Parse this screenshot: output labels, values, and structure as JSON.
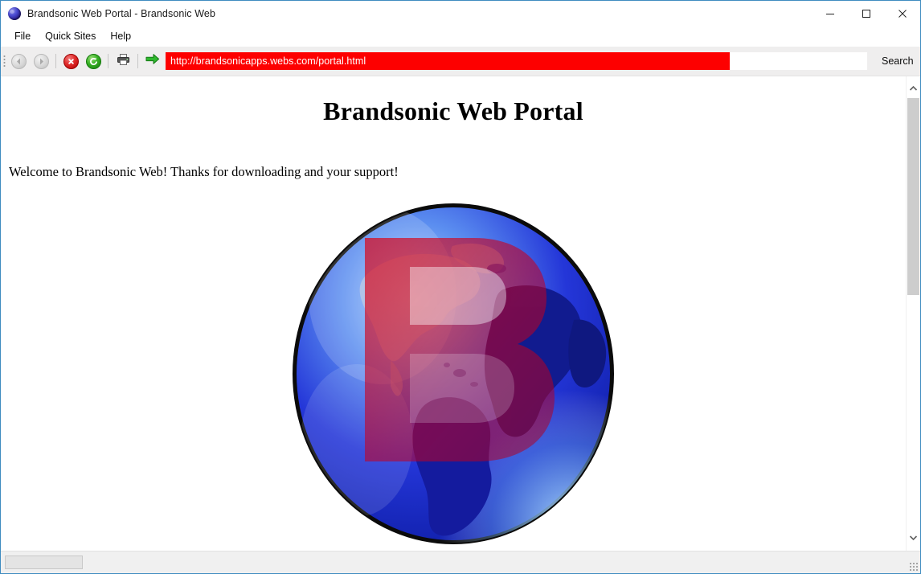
{
  "window": {
    "title": "Brandsonic Web Portal - Brandsonic Web",
    "app_icon": "globe-icon",
    "controls": {
      "minimize": "minimize-icon",
      "maximize": "maximize-icon",
      "close": "close-icon"
    }
  },
  "menubar": {
    "items": [
      {
        "label": "File"
      },
      {
        "label": "Quick Sites"
      },
      {
        "label": "Help"
      }
    ]
  },
  "toolbar": {
    "buttons": [
      {
        "name": "back-button",
        "icon": "arrow-left-icon",
        "enabled": false
      },
      {
        "name": "forward-button",
        "icon": "arrow-right-icon",
        "enabled": false
      },
      {
        "name": "stop-button",
        "icon": "stop-x-icon",
        "enabled": true
      },
      {
        "name": "refresh-button",
        "icon": "refresh-icon",
        "enabled": true
      },
      {
        "name": "print-button",
        "icon": "printer-icon",
        "enabled": true
      },
      {
        "name": "go-button",
        "icon": "arrow-right-go-icon",
        "enabled": true
      }
    ],
    "address": {
      "value": "http://brandsonicapps.webs.com/portal.html",
      "placeholder": "",
      "background_color": "#fd0000",
      "text_color": "#ffffff"
    },
    "search": {
      "value": "",
      "placeholder": "",
      "label": "Search"
    }
  },
  "page": {
    "heading": "Brandsonic Web Portal",
    "paragraph": "Welcome to Brandsonic Web! Thanks for downloading and your support!",
    "logo": {
      "name": "brandsonic-globe-logo",
      "letter": "B",
      "globe_color": "#1b2fd4",
      "letter_color": "#d00010",
      "outline_color": "#000000"
    }
  },
  "scrollbars": {
    "vertical": {
      "up": "chevron-up-icon",
      "down": "chevron-down-icon"
    },
    "horizontal": {
      "thumb": "scroll-thumb"
    },
    "resize_grip": "resize-grip-icon"
  }
}
